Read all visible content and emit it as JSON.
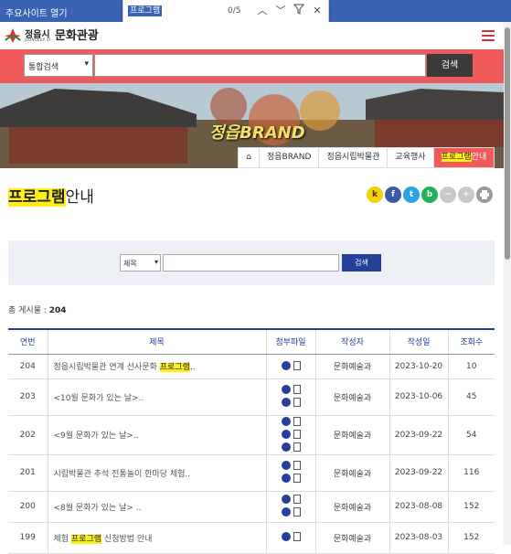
{
  "browser": {
    "skip_link": "주요사이트 열기",
    "find": {
      "query": "프로그램",
      "count": "0/5"
    }
  },
  "header": {
    "logo_city": "정읍시",
    "logo_en": "JEONGEUP SI",
    "site_name": "문화관광"
  },
  "search": {
    "select_value": "통합검색",
    "button": "검색"
  },
  "banner": {
    "brand_text": "정읍BRAND"
  },
  "tabs": [
    {
      "label": "정읍BRAND"
    },
    {
      "label": "정읍시립박물관"
    },
    {
      "label": "교육행사"
    },
    {
      "label_hl": "프로그램",
      "label_rest": "안내"
    }
  ],
  "page": {
    "title_hl": "프로그램",
    "title_rest": "안내"
  },
  "share": {
    "kakao": "k",
    "facebook": "f",
    "twitter": "t",
    "blog": "b",
    "minus": "−",
    "plus": "+"
  },
  "board_search": {
    "select_value": "제목",
    "button": "검색"
  },
  "total": {
    "label": "총 게시물 :",
    "count": "204"
  },
  "table": {
    "headers": [
      "연번",
      "제목",
      "첨부파일",
      "작성자",
      "작성일",
      "조회수"
    ],
    "rows": [
      {
        "no": "204",
        "pre": "정읍시립박물관 연계 선사문화 ",
        "hl": "프로그램",
        "post": "..",
        "writer": "문화예술과",
        "date": "2023-10-20",
        "views": "10",
        "files": 1
      },
      {
        "no": "203",
        "pre": "<10월 문화가 있는 날>..",
        "hl": "",
        "post": "",
        "writer": "문화예술과",
        "date": "2023-10-06",
        "views": "45",
        "files": 2
      },
      {
        "no": "202",
        "pre": "<9월 문화가 있는 날>..",
        "hl": "",
        "post": "",
        "writer": "문화예술과",
        "date": "2023-09-22",
        "views": "54",
        "files": 3
      },
      {
        "no": "201",
        "pre": "시립박물관 추석 전통놀이 한마당 체험..",
        "hl": "",
        "post": "",
        "writer": "문화예술과",
        "date": "2023-09-22",
        "views": "116",
        "files": 2
      },
      {
        "no": "200",
        "pre": "<8월 문화가 있는 날> ..",
        "hl": "",
        "post": "",
        "writer": "문화예술과",
        "date": "2023-08-08",
        "views": "152",
        "files": 2
      },
      {
        "no": "199",
        "pre": "체험 ",
        "hl": "프로그램",
        "post": " 신청방법 안내",
        "writer": "문화예술과",
        "date": "2023-08-03",
        "views": "152",
        "files": 1
      }
    ]
  }
}
